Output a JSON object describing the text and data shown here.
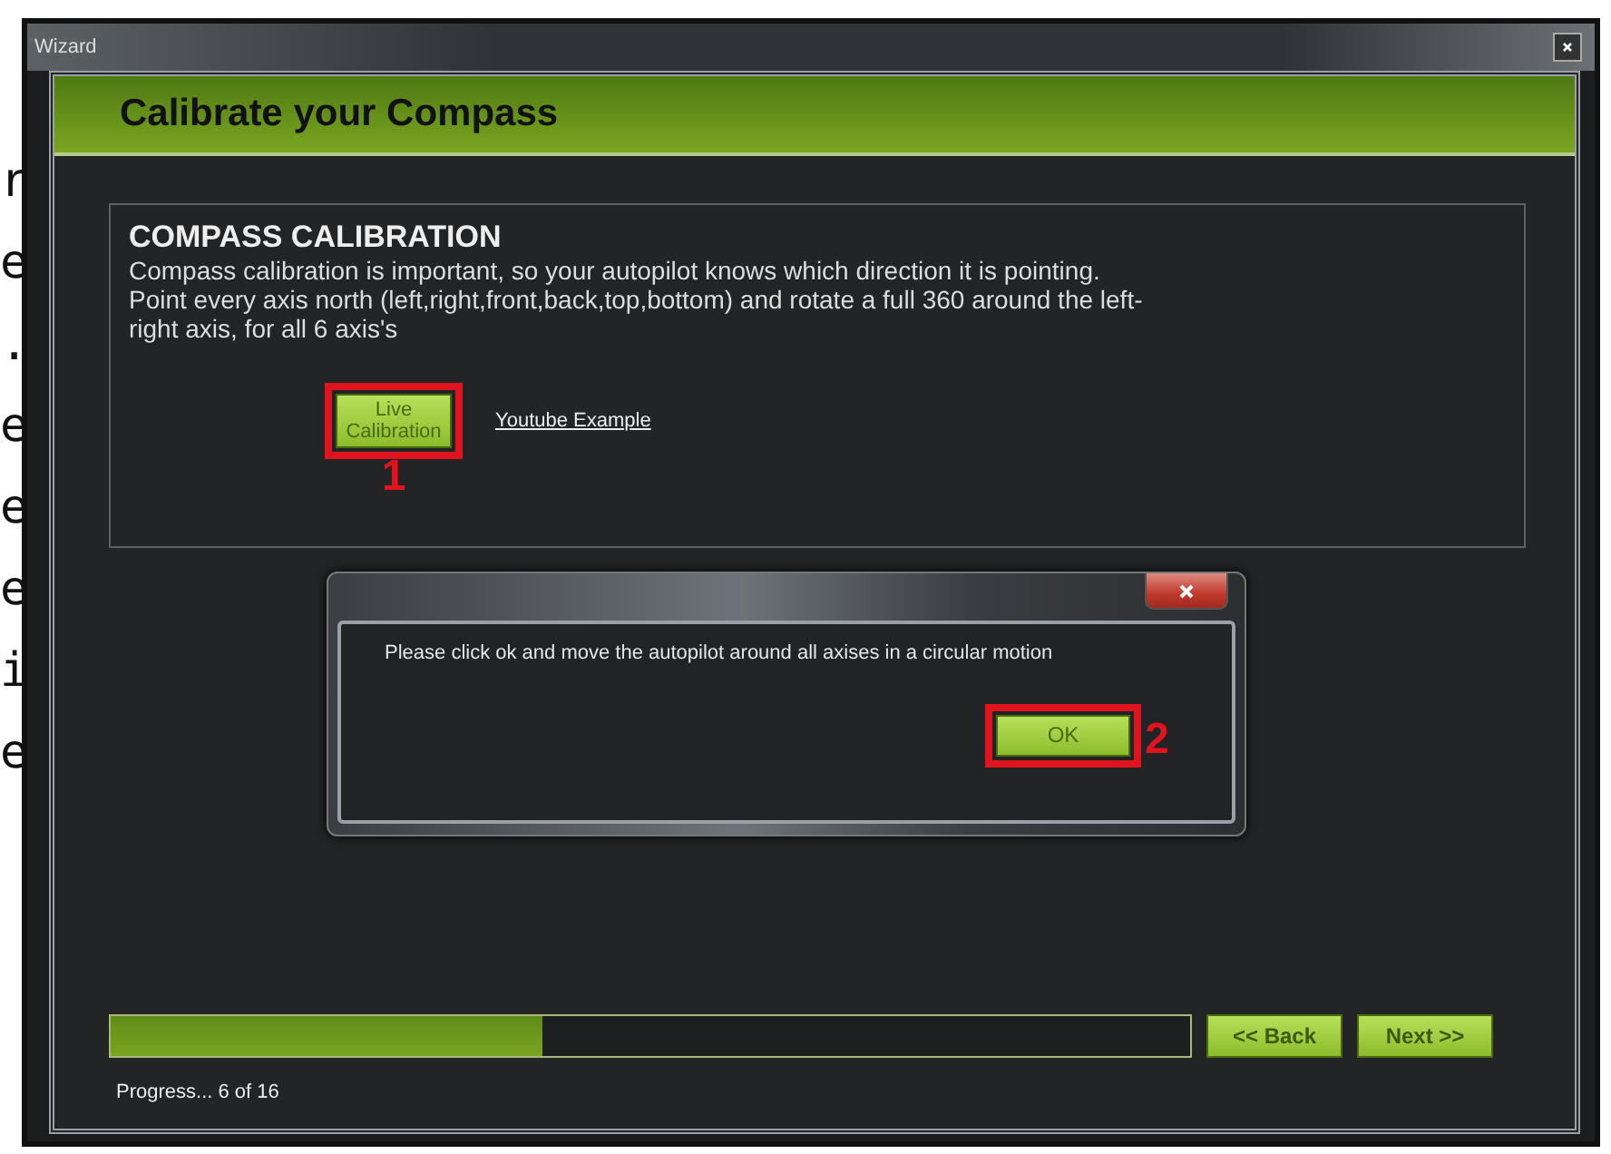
{
  "background_letters": [
    "r",
    "e",
    ".",
    "e",
    "e",
    "e",
    "i",
    "e"
  ],
  "window": {
    "title": "Wizard"
  },
  "header": {
    "title": "Calibrate your Compass"
  },
  "section": {
    "heading": "COMPASS CALIBRATION",
    "body": "Compass calibration is important, so your autopilot knows which direction it is pointing. Point every axis north (left,right,front,back,top,bottom) and rotate a full 360 around the left-right axis, for all 6 axis's"
  },
  "actions": [
    {
      "kind": "button",
      "label": "Live Calibration",
      "highlighted": true,
      "step": "1"
    },
    {
      "kind": "link",
      "label": "Youtube Example",
      "highlighted": false
    }
  ],
  "dialog": {
    "message": "Please click ok and move the autopilot around all axises in a circular motion",
    "button": {
      "label": "OK",
      "highlighted": true,
      "step": "2"
    }
  },
  "progress": {
    "level": 0.4,
    "text": "Progress... 6 of 16"
  },
  "nav_buttons": [
    "<< Back",
    "Next >>"
  ]
}
